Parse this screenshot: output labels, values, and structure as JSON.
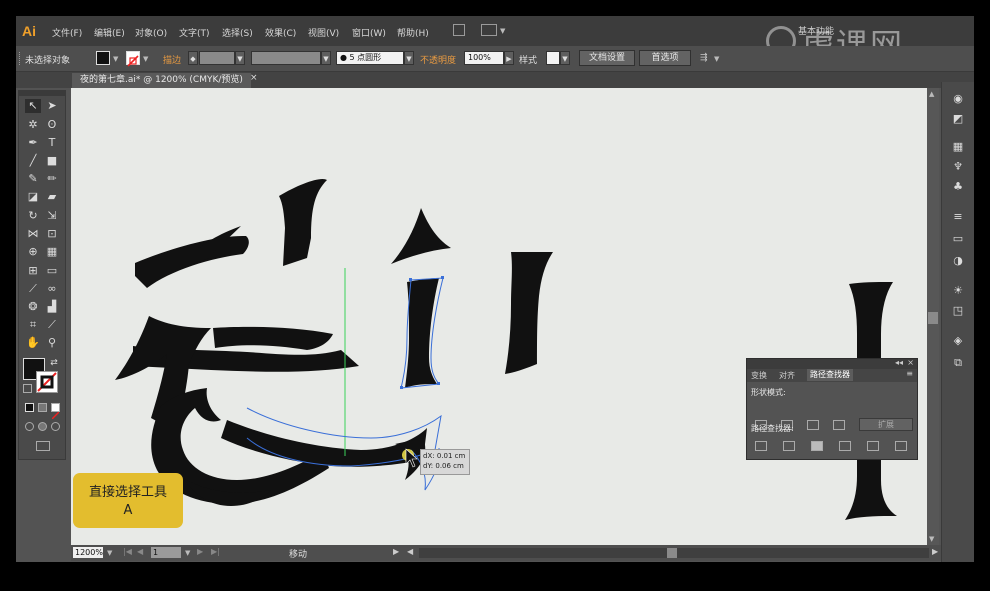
{
  "app": {
    "logo": "Ai"
  },
  "menu": {
    "items": [
      "文件(F)",
      "编辑(E)",
      "对象(O)",
      "文字(T)",
      "选择(S)",
      "效果(C)",
      "视图(V)",
      "窗口(W)",
      "帮助(H)"
    ],
    "workspace": "基本功能"
  },
  "watermark": {
    "text": "虎课网"
  },
  "control_bar": {
    "selection_status": "未选择对象",
    "stroke_label": "描边",
    "brush_value": "5 点圆形",
    "opacity_label": "不透明度",
    "opacity_value": "100%",
    "style_label": "样式",
    "doc_setup_button": "文档设置",
    "preferences_button": "首选项"
  },
  "document_tab": {
    "title": "夜的第七章.ai* @ 1200% (CMYK/预览)",
    "close": "×"
  },
  "status_bar": {
    "zoom": "1200%",
    "page": "1",
    "status": "移动"
  },
  "tool_tip_card": {
    "tool_name": "直接选择工具",
    "shortcut": "A"
  },
  "drag_feedback": {
    "dx": "dX: 0.01 cm",
    "dy": "dY: 0.06 cm"
  },
  "pathfinder_panel": {
    "tabs": [
      "变换",
      "对齐",
      "路径查找器"
    ],
    "shape_modes_label": "形状模式:",
    "expand_button": "扩展",
    "pathfinders_label": "路径查找器:"
  },
  "colors": {
    "accent_orange": "#e79a42",
    "card_yellow": "#e3bd2e",
    "path_blue": "#3a6fd8",
    "guide_green": "#3ad35a",
    "glyph_black": "#111111"
  }
}
